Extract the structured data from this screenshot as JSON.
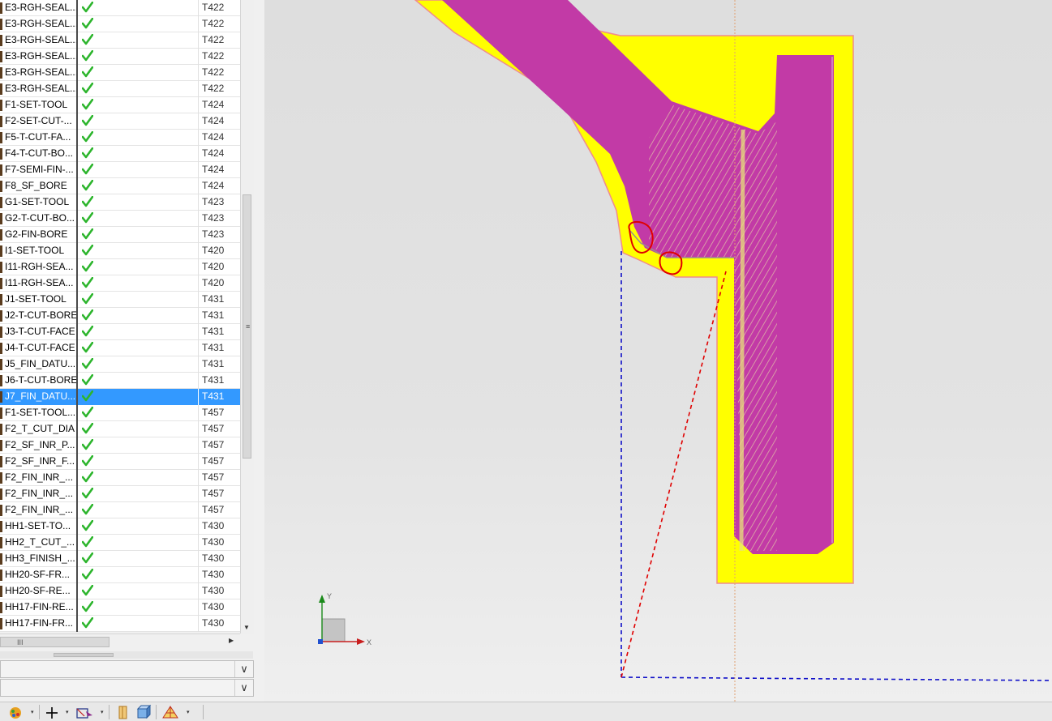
{
  "operations": [
    {
      "name": "E3-RGH-SEAL...",
      "status": "complete",
      "tool": "T422"
    },
    {
      "name": "E3-RGH-SEAL...",
      "status": "complete",
      "tool": "T422"
    },
    {
      "name": "E3-RGH-SEAL...",
      "status": "complete",
      "tool": "T422"
    },
    {
      "name": "E3-RGH-SEAL...",
      "status": "complete",
      "tool": "T422"
    },
    {
      "name": "E3-RGH-SEAL...",
      "status": "complete",
      "tool": "T422"
    },
    {
      "name": "E3-RGH-SEAL...",
      "status": "complete",
      "tool": "T422"
    },
    {
      "name": "F1-SET-TOOL",
      "status": "complete",
      "tool": "T424"
    },
    {
      "name": "F2-SET-CUT-...",
      "status": "complete",
      "tool": "T424"
    },
    {
      "name": "F5-T-CUT-FA...",
      "status": "complete",
      "tool": "T424"
    },
    {
      "name": "F4-T-CUT-BO...",
      "status": "complete",
      "tool": "T424"
    },
    {
      "name": "F7-SEMI-FIN-...",
      "status": "complete",
      "tool": "T424"
    },
    {
      "name": "F8_SF_BORE",
      "status": "complete",
      "tool": "T424"
    },
    {
      "name": "G1-SET-TOOL",
      "status": "complete",
      "tool": "T423"
    },
    {
      "name": "G2-T-CUT-BO...",
      "status": "complete",
      "tool": "T423"
    },
    {
      "name": "G2-FIN-BORE",
      "status": "complete",
      "tool": "T423"
    },
    {
      "name": "I1-SET-TOOL",
      "status": "complete",
      "tool": "T420"
    },
    {
      "name": "I11-RGH-SEA...",
      "status": "complete",
      "tool": "T420"
    },
    {
      "name": "I11-RGH-SEA...",
      "status": "complete",
      "tool": "T420"
    },
    {
      "name": "J1-SET-TOOL",
      "status": "complete",
      "tool": "T431"
    },
    {
      "name": "J2-T-CUT-BORE",
      "status": "complete",
      "tool": "T431"
    },
    {
      "name": "J3-T-CUT-FACE",
      "status": "complete",
      "tool": "T431"
    },
    {
      "name": "J4-T-CUT-FACE",
      "status": "complete",
      "tool": "T431"
    },
    {
      "name": "J5_FIN_DATU...",
      "status": "complete",
      "tool": "T431"
    },
    {
      "name": "J6-T-CUT-BORE",
      "status": "complete",
      "tool": "T431"
    },
    {
      "name": "J7_FIN_DATU...",
      "status": "complete",
      "tool": "T431",
      "selected": true
    },
    {
      "name": "F1-SET-TOOL...",
      "status": "complete",
      "tool": "T457"
    },
    {
      "name": "F2_T_CUT_DIA",
      "status": "complete",
      "tool": "T457"
    },
    {
      "name": "F2_SF_INR_P...",
      "status": "complete",
      "tool": "T457"
    },
    {
      "name": "F2_SF_INR_F...",
      "status": "complete",
      "tool": "T457"
    },
    {
      "name": "F2_FIN_INR_...",
      "status": "complete",
      "tool": "T457"
    },
    {
      "name": "F2_FIN_INR_...",
      "status": "complete",
      "tool": "T457"
    },
    {
      "name": "F2_FIN_INR_...",
      "status": "complete",
      "tool": "T457"
    },
    {
      "name": "HH1-SET-TO...",
      "status": "complete",
      "tool": "T430"
    },
    {
      "name": "HH2_T_CUT_...",
      "status": "complete",
      "tool": "T430"
    },
    {
      "name": "HH3_FINISH_...",
      "status": "complete",
      "tool": "T430"
    },
    {
      "name": "HH20-SF-FR...",
      "status": "complete",
      "tool": "T430"
    },
    {
      "name": "HH20-SF-RE...",
      "status": "complete",
      "tool": "T430"
    },
    {
      "name": "HH17-FIN-RE...",
      "status": "complete",
      "tool": "T430"
    },
    {
      "name": "HH17-FIN-FR...",
      "status": "complete",
      "tool": "T430"
    }
  ],
  "scrollbar": {
    "grip": "≡",
    "down_arrow": "▼",
    "horizontal_grip": "III",
    "right_arrow": "▶"
  },
  "combos": [
    {
      "value": "",
      "arrow": "∨"
    },
    {
      "value": "",
      "arrow": "∨"
    }
  ],
  "triad": {
    "x_label": "X",
    "y_label": "Y"
  },
  "colors": {
    "accent_selected": "#3399ff",
    "check_green": "#2db52d",
    "stock_yellow": "#ffff00",
    "part_magenta": "#c23aa6",
    "annotation_red": "#e00000",
    "tool_path_red": "#e00000",
    "tool_path_blue": "#1010c8"
  },
  "toolbar": {
    "icons": [
      "render-style-icon",
      "wcs-cross-icon",
      "select-filter-icon",
      "part-column-icon",
      "box-view-icon",
      "snap-mesh-icon"
    ],
    "dropdown_arrow": "▾"
  }
}
